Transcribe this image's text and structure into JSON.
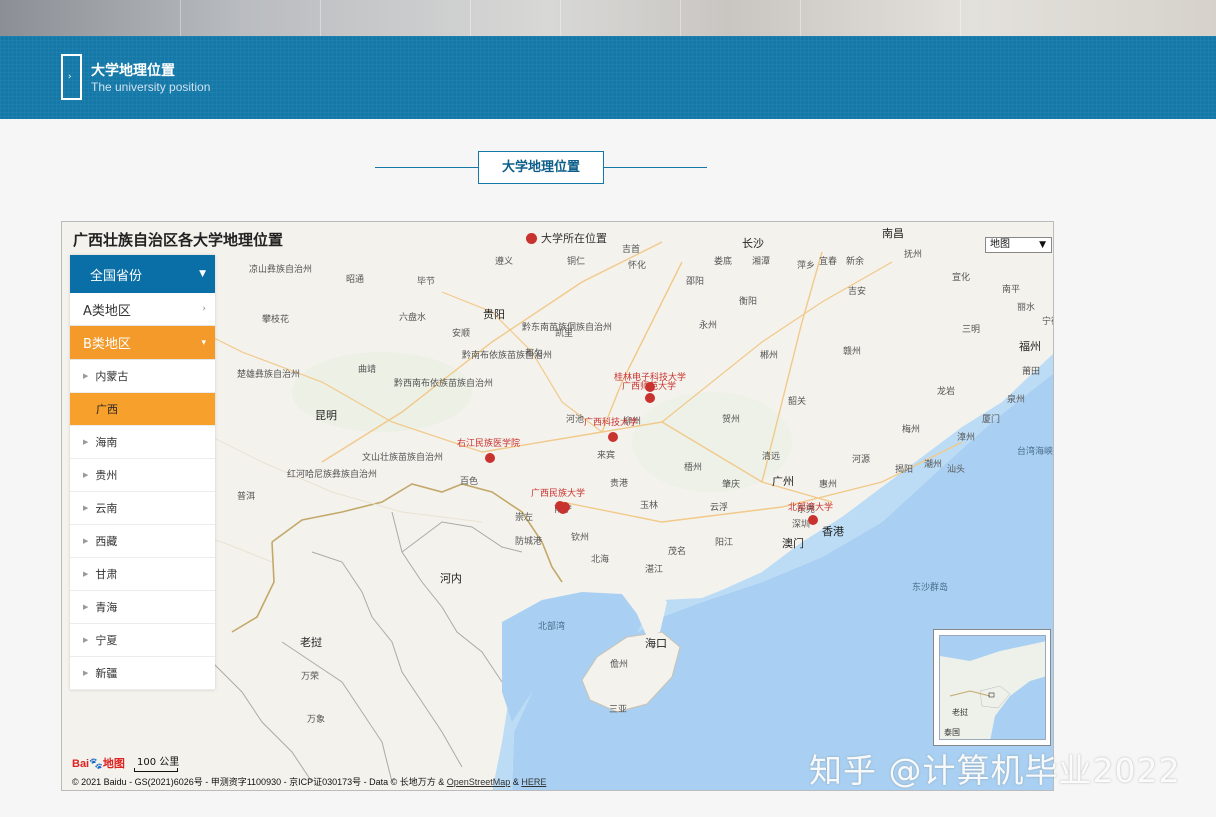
{
  "banner": {
    "title": "大学地理位置",
    "subtitle": "The university position"
  },
  "section_title": "大学地理位置",
  "map": {
    "heading": "广西壮族自治区各大学地理位置",
    "legend_label": "大学所在位置",
    "map_type": "地图",
    "scale_label": "100 公里",
    "logo_text": "Bai",
    "logo_text2": "地图",
    "copyright_prefix": "© 2021 Baidu - GS(2021)6026号 - 甲测资字1100930 - 京ICP证030173号 - Data © 长地万方 & ",
    "copyright_link1": "OpenStreetMap",
    "copyright_amp": " & ",
    "copyright_link2": "HERE",
    "marker_color": "#c8322f",
    "markers": [
      {
        "label": "桂林电子科技大学"
      },
      {
        "label": "广西师范大学"
      },
      {
        "label": "广西科技大学"
      },
      {
        "label": "右江民族医学院"
      },
      {
        "label": "广西民族大学"
      },
      {
        "label": "北部湾大学"
      }
    ],
    "places": [
      "南昌",
      "长沙",
      "湘潭",
      "萍乡",
      "宜春",
      "新余",
      "抚州",
      "怀化",
      "邵阳",
      "娄底",
      "衡阳",
      "吉安",
      "遵义",
      "铜仁",
      "贵阳",
      "永州",
      "郴州",
      "赣州",
      "福州",
      "莆田",
      "泉州",
      "厦门",
      "漳州",
      "汕头",
      "潮州",
      "揭阳",
      "梅州",
      "河源",
      "惠州",
      "韶关",
      "清远",
      "广州",
      "东莞",
      "深圳",
      "香港",
      "澳门",
      "肇庆",
      "云浮",
      "阳江",
      "茂名",
      "湛江",
      "北海",
      "钦州",
      "防城港",
      "南宁",
      "玉林",
      "贵港",
      "梧州",
      "贺州",
      "来宾",
      "柳州",
      "河池",
      "百色",
      "崇左",
      "昆明",
      "曲靖",
      "昭通",
      "毕节",
      "六盘水",
      "安顺",
      "都匀",
      "凯里",
      "海口",
      "儋州",
      "三亚",
      "北部湾",
      "河内",
      "老挝",
      "万荣",
      "万象",
      "台湾海峡",
      "东沙群岛",
      "凉山彝族自治州",
      "攀枝花",
      "楚雄彝族自治州",
      "红河哈尼族彝族自治州",
      "文山壮族苗族自治州",
      "黔西南布依族苗族自治州",
      "黔南布依族苗族自治州",
      "黔东南苗族侗族自治州",
      "普洱",
      "丽水",
      "南平",
      "三明",
      "龙岩",
      "宁德",
      "宣化",
      "吉首"
    ],
    "overview_labels": [
      "老挝",
      "泰国"
    ]
  },
  "sidebar": {
    "all_label": "全国省份",
    "cat_a_label": "A类地区",
    "cat_b_label": "B类地区",
    "provinces": [
      {
        "label": "内蒙古",
        "active": false
      },
      {
        "label": "广西",
        "active": true
      },
      {
        "label": "海南",
        "active": false
      },
      {
        "label": "贵州",
        "active": false
      },
      {
        "label": "云南",
        "active": false
      },
      {
        "label": "西藏",
        "active": false
      },
      {
        "label": "甘肃",
        "active": false
      },
      {
        "label": "青海",
        "active": false
      },
      {
        "label": "宁夏",
        "active": false
      },
      {
        "label": "新疆",
        "active": false
      }
    ]
  },
  "watermark": "知乎 @计算机毕业2022"
}
